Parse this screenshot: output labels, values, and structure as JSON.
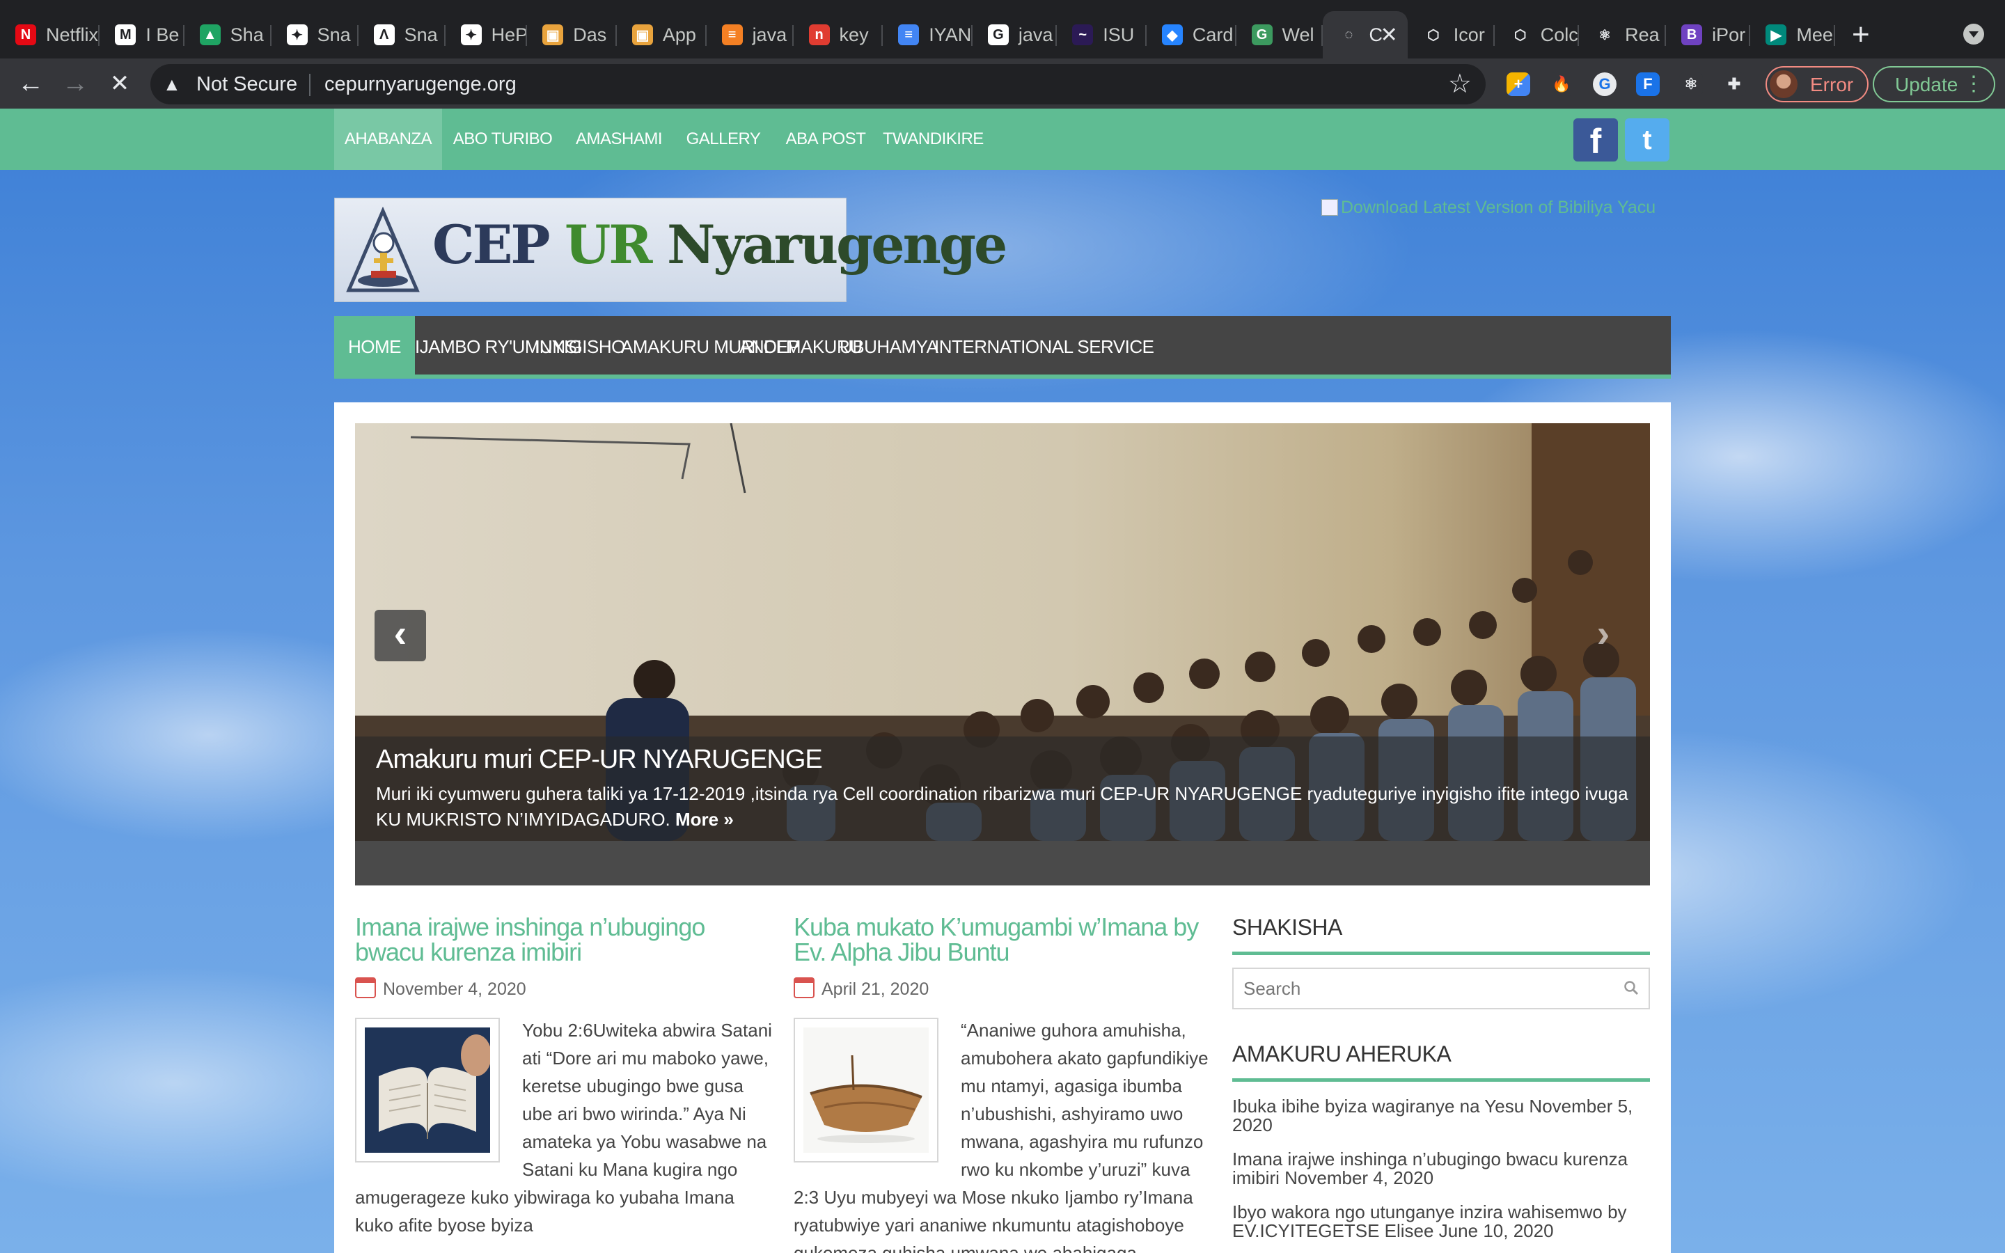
{
  "browser": {
    "tabs": [
      {
        "label": "Netflix",
        "fav_color": "#e50914",
        "fav_glyph": "N"
      },
      {
        "label": "I Be",
        "fav_color": "#ffffff",
        "fav_glyph": "M"
      },
      {
        "label": "Sha",
        "fav_color": "#1fa463",
        "fav_glyph": "▲"
      },
      {
        "label": "Sna",
        "fav_color": "#ffffff",
        "fav_glyph": "✦"
      },
      {
        "label": "Sna",
        "fav_color": "#ffffff",
        "fav_glyph": "Λ"
      },
      {
        "label": "HeP",
        "fav_color": "#ffffff",
        "fav_glyph": "✦"
      },
      {
        "label": "Das",
        "fav_color": "#e8a33d",
        "fav_glyph": "▣"
      },
      {
        "label": "App",
        "fav_color": "#e8a33d",
        "fav_glyph": "▣"
      },
      {
        "label": "java",
        "fav_color": "#f48024",
        "fav_glyph": "≡"
      },
      {
        "label": "key",
        "fav_color": "#e03c31",
        "fav_glyph": "n"
      },
      {
        "label": "IYAN",
        "fav_color": "#4285f4",
        "fav_glyph": "≡"
      },
      {
        "label": "java",
        "fav_color": "#ffffff",
        "fav_glyph": "G"
      },
      {
        "label": "ISU",
        "fav_color": "#2b1a55",
        "fav_glyph": "~"
      },
      {
        "label": "Card",
        "fav_color": "#2684ff",
        "fav_glyph": "◆"
      },
      {
        "label": "Wel",
        "fav_color": "#3c9a5f",
        "fav_glyph": "G"
      },
      {
        "label": "C",
        "fav_color": "#35363a",
        "fav_glyph": "◌"
      },
      {
        "label": "Icor",
        "fav_color": "#35363a",
        "fav_glyph": "⬡"
      },
      {
        "label": "Colc",
        "fav_color": "#35363a",
        "fav_glyph": "⬡"
      },
      {
        "label": "Rea",
        "fav_color": "#35363a",
        "fav_glyph": "⚛"
      },
      {
        "label": "iPor",
        "fav_color": "#6f42c1",
        "fav_glyph": "B"
      },
      {
        "label": "Mee",
        "fav_color": "#00897b",
        "fav_glyph": "▶"
      }
    ],
    "not_secure": "Not Secure",
    "url": "cepurnyarugenge.org",
    "profile_status": "Error",
    "update_label": "Update"
  },
  "site": {
    "top_nav": [
      "AHABANZA",
      "ABO TURIBO",
      "AMASHAMI",
      "GALLERY",
      "ABA POST",
      "TWANDIKIRE"
    ],
    "logo": {
      "part1": "CEP ",
      "part2": "UR ",
      "part3": "Nyarugenge"
    },
    "download_link": "Download Latest Version of Bibiliya Yacu",
    "main_nav": [
      "HOME",
      "IJAMBO RY'UMUNSI",
      "INYIGISHO",
      "AMAKURU MURI CEP",
      "ANDI MAKURU",
      "UBUHAMYA",
      "INTERNATIONAL SERVICE"
    ],
    "slider": {
      "title": "Amakuru muri CEP-UR NYARUGENGE",
      "text": "Muri iki cyumweru guhera taliki ya 17-12-2019 ,itsinda rya Cell coordination ribarizwa muri CEP-UR NYARUGENGE ryaduteguriye inyigisho ifite intego ivuga KU MUKRISTO N’IMYIDAGADURO.",
      "more": "More »",
      "prev": "‹",
      "next": "›"
    },
    "posts": [
      {
        "title": "Imana irajwe inshinga n’ubugingo bwacu kurenza imibiri",
        "date": "November 4, 2020",
        "excerpt": "Yobu 2:6Uwiteka abwira Satani ati “Dore ari mu maboko yawe, keretse ubugingo bwe gusa ube ari bwo wirinda.” Aya Ni amateka ya Yobu wasabwe na Satani ku Mana kugira ngo amugerageze kuko yibwiraga ko yubaha Imana kuko afite byose byiza"
      },
      {
        "title": "Kuba mukato K’umugambi w’Imana by Ev. Alpha Jibu Buntu",
        "date": "April 21, 2020",
        "excerpt": "“Ananiwe guhora amuhisha, amubohera akato gapfundikiye mu ntamyi, agasiga ibumba n’ubushishi, ashyiramo uwo mwana, agashyira mu rufunzo rwo ku nkombe y’uruzi” kuva 2:3 Uyu mubyeyi wa Mose nkuko Ijambo ry’Imana ryatubwiye yari ananiwe nkumuntu atagishoboye gukomeza guhisha umwana we abahigaga"
      }
    ],
    "sidebar": {
      "search_title": "SHAKISHA",
      "search_placeholder": "Search",
      "recent_title": "AMAKURU AHERUKA",
      "recent": [
        {
          "title": "Ibuka ibihe byiza wagiranye na Yesu",
          "date": "November 5, 2020"
        },
        {
          "title": "Imana irajwe inshinga n’ubugingo bwacu kurenza imibiri",
          "date": "November 4, 2020"
        },
        {
          "title": "Ibyo wakora ngo utunganye inzira wahisemwo by EV.ICYITEGETSE Elisee",
          "date": "June 10, 2020"
        }
      ]
    },
    "colors": {
      "accent": "#5fbc93",
      "nav_dark": "#454545"
    }
  }
}
